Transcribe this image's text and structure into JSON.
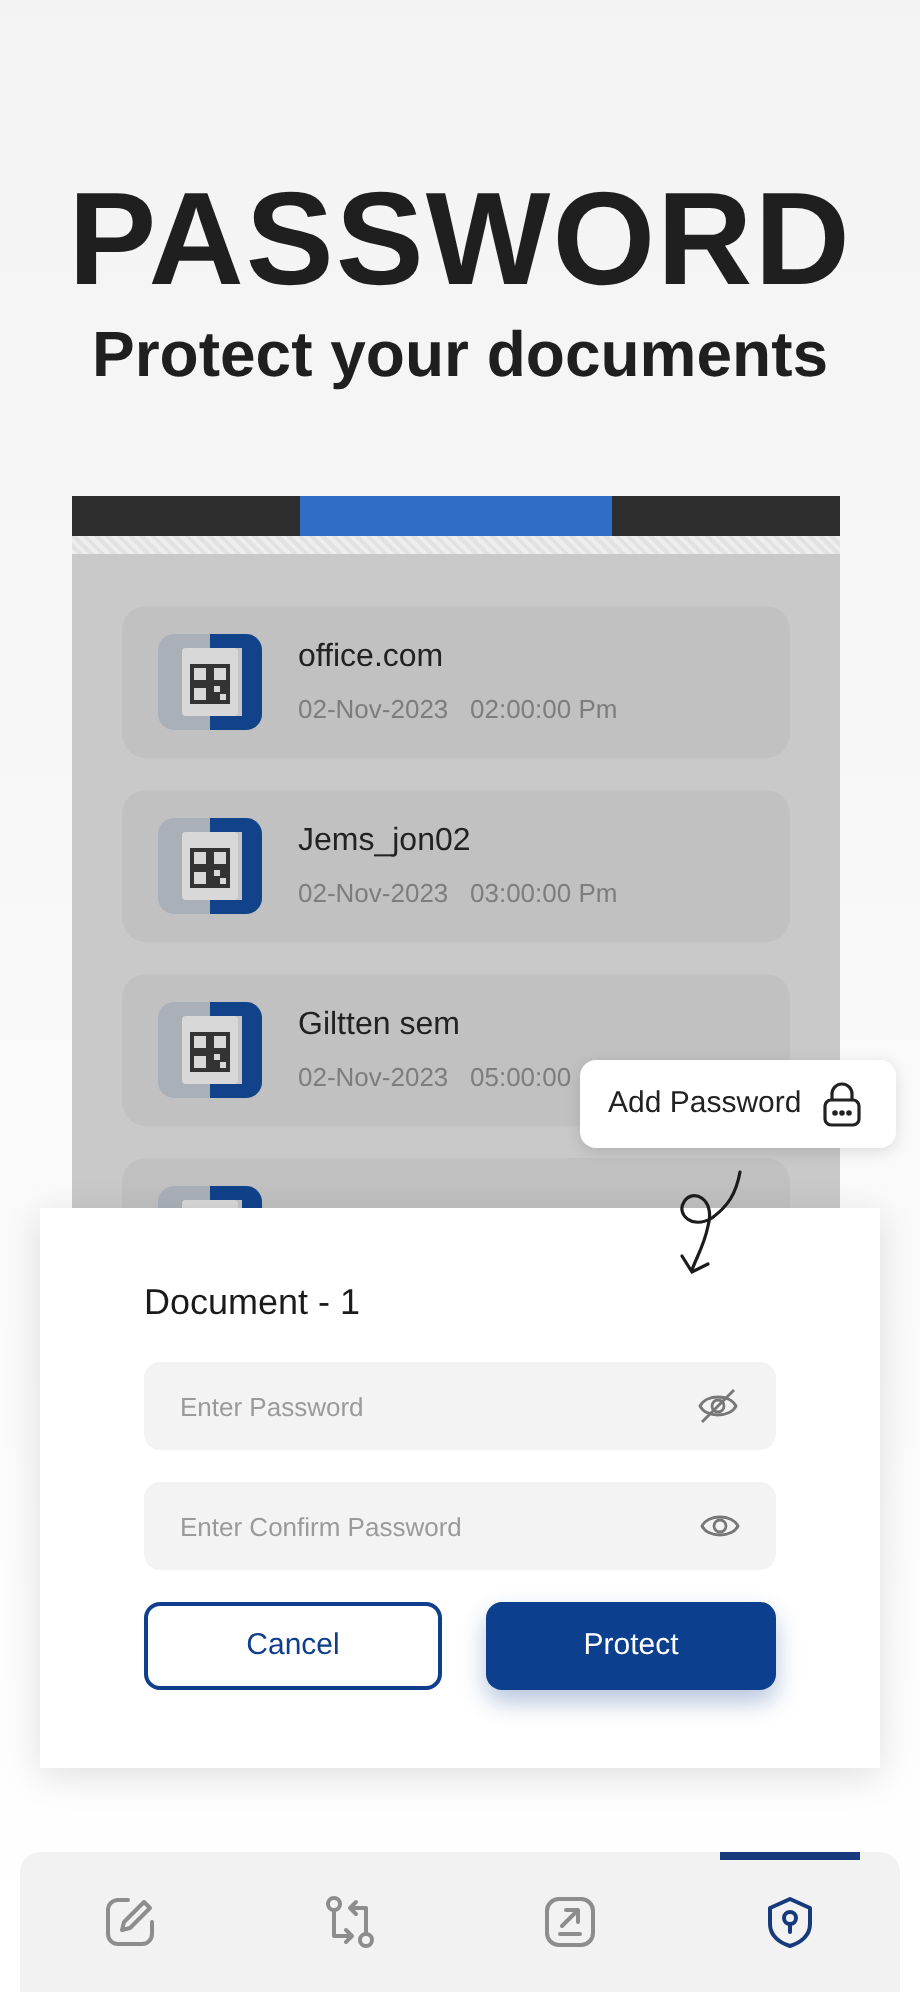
{
  "headline": "PASSWORD",
  "subheadline": "Protect your documents",
  "phone": {
    "tabs": [
      {
        "selected": false
      },
      {
        "selected": true
      },
      {
        "selected": false
      }
    ],
    "documents": [
      {
        "kind": "full",
        "name": "office.com",
        "date": "02-Nov-2023",
        "time": "02:00:00 Pm"
      },
      {
        "kind": "full",
        "name": "Jems_jon02",
        "date": "02-Nov-2023",
        "time": "03:00:00 Pm"
      },
      {
        "kind": "full",
        "name": "Giltten sem",
        "date": "02-Nov-2023",
        "time": "05:00:00"
      },
      {
        "kind": "cut"
      }
    ]
  },
  "tooltip": {
    "label": "Add Password"
  },
  "dialog": {
    "title": "Document - 1",
    "fields": [
      {
        "placeholder": "Enter Password",
        "masked": true
      },
      {
        "placeholder": "Enter Confirm Password",
        "masked": false
      }
    ],
    "buttons": [
      {
        "label": "Cancel",
        "kind": "outline"
      },
      {
        "label": "Protect",
        "kind": "primary"
      }
    ]
  },
  "nav": [
    {
      "kind": "edit",
      "selected": false
    },
    {
      "kind": "compare",
      "selected": false
    },
    {
      "kind": "export",
      "selected": false
    },
    {
      "kind": "protect",
      "selected": true
    }
  ]
}
